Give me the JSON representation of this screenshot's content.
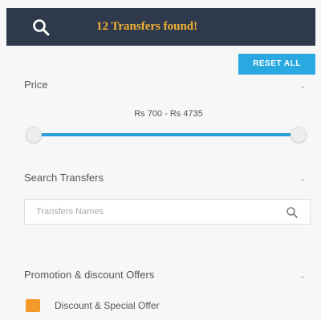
{
  "header": {
    "count_text": "12 Transfers found!",
    "icon": "search-icon"
  },
  "reset_button": {
    "label": "RESET ALL",
    "color": "#29a9e0"
  },
  "sections": {
    "price": {
      "title": "Price",
      "range_text": "Rs 700 - Rs 4735",
      "min_fraction": 0.0,
      "max_fraction": 1.0
    },
    "search_transfers": {
      "title": "Search Transfers",
      "placeholder": "Transfers Names"
    },
    "promotion": {
      "title": "Promotion & discount Offers",
      "options": [
        {
          "label": "Discount & Special Offer",
          "color": "#f39a2b"
        }
      ]
    }
  },
  "colors": {
    "header_bg": "#2e3a4b",
    "header_text": "#f2b134",
    "accent": "#29a9e0",
    "slider": "#2aa0d8"
  }
}
